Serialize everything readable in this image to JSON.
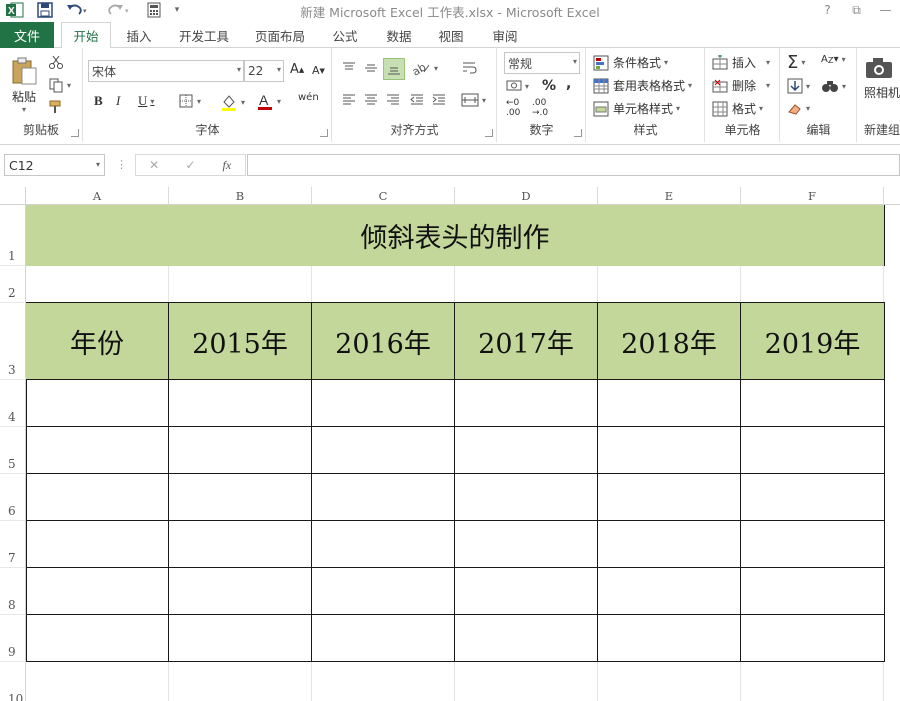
{
  "titlebar": {
    "title": "新建 Microsoft Excel 工作表.xlsx - Microsoft Excel",
    "help": "?",
    "restore": "⧉",
    "minimize": "—",
    "maximize": "□"
  },
  "tabs": {
    "file": "文件",
    "items": [
      "开始",
      "插入",
      "开发工具",
      "页面布局",
      "公式",
      "数据",
      "视图",
      "审阅"
    ],
    "active_index": 0
  },
  "ribbon": {
    "clipboard": {
      "paste": "粘贴",
      "label": "剪贴板"
    },
    "font": {
      "name": "宋体",
      "size": "22",
      "bold": "B",
      "italic": "I",
      "underline": "U",
      "wen": "wén",
      "label": "字体"
    },
    "alignment": {
      "label": "对齐方式"
    },
    "number": {
      "format": "常规",
      "percent": "%",
      "comma": ",",
      "label": "数字"
    },
    "styles": {
      "conditional": "条件格式",
      "table": "套用表格格式",
      "cell": "单元格样式",
      "label": "样式"
    },
    "cells": {
      "insert": "插入",
      "delete": "删除",
      "format": "格式",
      "label": "单元格"
    },
    "editing": {
      "label": "编辑"
    },
    "new_group": {
      "camera": "照相机",
      "label": "新建组"
    }
  },
  "formula_bar": {
    "name_box": "C12",
    "cancel": "✕",
    "enter": "✓",
    "fx": "fx",
    "value": ""
  },
  "sheet": {
    "columns": [
      "A",
      "B",
      "C",
      "D",
      "E",
      "F"
    ],
    "rows": [
      "1",
      "2",
      "3",
      "4",
      "5",
      "6",
      "7",
      "8",
      "9",
      "10"
    ],
    "title": "倾斜表头的制作",
    "header_row": [
      "年份",
      "2015年",
      "2016年",
      "2017年",
      "2018年",
      "2019年"
    ]
  },
  "colors": {
    "excel_green": "#217346",
    "header_fill": "#c4d79b"
  }
}
